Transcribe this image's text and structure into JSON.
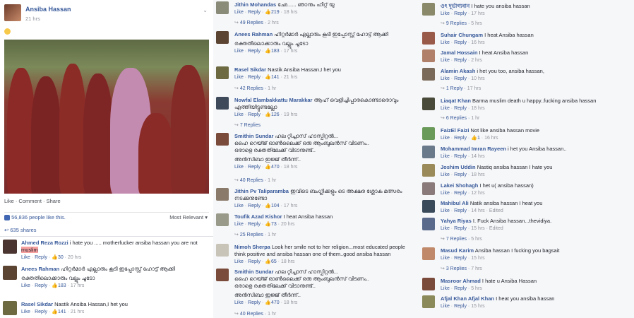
{
  "post": {
    "author": "Ansiba Hassan",
    "time": "21 hrs",
    "actions": "Like · Comment · Share",
    "likes_count": "56,836 people like this.",
    "most_relevant": "Most Relevant ▾",
    "shares": "635 shares"
  },
  "col1_comments": [
    {
      "name": "Ahmed Reza Rozzi",
      "text_pre": "i hate you ..... motherfucker ansiba hassan you are not",
      "highlight": "muslim",
      "text_post": "",
      "likes": "30",
      "time": "20 hrs"
    },
    {
      "name": "Anees Rahman",
      "text_pre": "ഹിറ്റർമാർ എല്ലാരും കൂടി ഇപ്പോസ്റ്റ് ഹോട്ട് ആക്കി",
      "text2": "രക്തതിലൊക്കാരും വല്ലും ചൂടോ",
      "likes": "183",
      "time": "17 hrs"
    },
    {
      "name": "Rasel Sikdar",
      "text_pre": "Nastik Ansiba Hassan,I het you",
      "likes": "141",
      "time": "21 hrs"
    }
  ],
  "col2_comments": [
    {
      "name": "Jithin Mohandas",
      "text": "ഛേ...... ഞാനും ഹിറ്റ് യു",
      "likes": "219",
      "time": "18 hrs",
      "replies": "49 Replies",
      "replies_time": "2 hrs"
    },
    {
      "name": "Anees Rahman",
      "text": "ഹിറ്റർമാർ എല്ലാരും കൂടി ഇപ്പോസ്റ്റ് ഹോട്ട് ആക്കി",
      "text2": "രക്തതിലൊക്കാരും വല്ലും ചൂടോ",
      "likes": "183",
      "time": "17 hrs"
    },
    {
      "name": "Rasel Sikdar",
      "text": "Nastik Ansiba Hassan,I het you",
      "likes": "141",
      "time": "21 hrs",
      "replies": "42 Replies",
      "replies_time": "1 hr"
    },
    {
      "name": "Nowfal Elambakkattu Marakkar",
      "text": "ആഹ് വെളിച്ചിപ്പാരകൊണ്ടാരൊവും എത്തിയിട്ടുണ്ടല്ലോ",
      "likes": "126",
      "time": "19 hrs",
      "replies": "7 Replies"
    },
    {
      "name": "Smithin Sundar",
      "text": "ഹല റ്റിച്ചാസ് ഹാസ്പിറ്റൽ...",
      "text2": "ഹൈ റെയ്ജ് ഓൺലൈക്ക് ഒരു ആംബുലൻസ് വിടണം..",
      "text3": "ഒരാളെ രക്തതിലേക്ക് വിടാനുണ്ട്..",
      "text4": "അൻസിബാ ഇജ്ജ് തീർന്ന്..",
      "likes": "470",
      "time": "18 hrs",
      "replies": "40 Replies",
      "replies_time": "1 hr"
    },
    {
      "name": "Jithin Pv Taliparamba",
      "text": "ഇവിടെ ബംഗ്ലിക്കളും ടെ അക്ഷര ശ്ലോക മത്സരം നടക്കുനുണ്ടോ",
      "likes": "104",
      "time": "17 hrs"
    },
    {
      "name": "Toufik Azad Kishor",
      "text": "I heat Ansiba hassan",
      "likes": "73",
      "time": "20 hrs",
      "replies": "25 Replies",
      "replies_time": "1 hr"
    },
    {
      "name": "Nimoh Sherpa",
      "text": "Look her smile not to her religion...most educated people think positive and ansiba hassan one of them..good ansiba hassan",
      "likes": "65",
      "time": "18 hrs"
    },
    {
      "name": "Smithin Sundar",
      "text": "ഹല റ്റിച്ചാസ് ഹാസ്പിറ്റൽ...",
      "text2": "ഹൈ റെയ്ജ് ഓൺലൈക്ക് ഒരു ആംബുലൻസ് വിടണം..",
      "text3": "ഒരാളെ രക്തതിലേക്ക് വിടാനുണ്ട്..",
      "text4": "അൻസിബാ ഇജ്ജ് തീർന്ന്..",
      "likes": "470",
      "time": "18 hrs",
      "replies": "40 Replies",
      "replies_time": "1 hr"
    }
  ],
  "col3_comments": [
    {
      "name": "ওৎ দূর্ভাগ্যবান",
      "text": "I hate you ansiba hassan",
      "time": "17 hrs",
      "replies": "9 Replies",
      "replies_time": "5 hrs"
    },
    {
      "name": "Suhair Chungam",
      "text": "I heat Ansiba hassan",
      "time": "16 hrs"
    },
    {
      "name": "Jamal Hossain",
      "text": "I heat Ansiba hassan",
      "time": "2 hrs"
    },
    {
      "name": "Alamin Akash",
      "text": "i het you too, ansiba hassan,",
      "time": "10 hrs",
      "replies": "1 Reply",
      "replies_time": "17 hrs"
    },
    {
      "name": "Liaqat Khan",
      "text": "Barma muslim death u happy..fucking ansiba hassan",
      "time": "18 hrs",
      "replies": "6 Replies",
      "replies_time": "1 hr"
    },
    {
      "name": "FaizEl Faizi",
      "text": "Not like ansiba hassan movie",
      "likes": "1",
      "time": "16 hrs"
    },
    {
      "name": "Mohammad Imran Rayeen",
      "text": "i het you Ansiba hassan..",
      "time": "14 hrs"
    },
    {
      "name": "Joshim Uddin",
      "text": "Nastiq ansiba hassan I hate you",
      "time": "18 hrs"
    },
    {
      "name": "Lakei Shohagh",
      "text": "I het u( ansiba hassan)",
      "time": "12 hrs"
    },
    {
      "name": "Mahibul Ali",
      "text": "Natik ansiba hassan I heat you",
      "time": "14 hrs",
      "edited": "Edited"
    },
    {
      "name": "Yahya Riyas",
      "text": "I. Fuck Ansiba hassan...thevidiya.",
      "time": "15 hrs",
      "edited": "Edited",
      "replies": "7 Replies",
      "replies_time": "5 hrs"
    },
    {
      "name": "Masud Karim",
      "text": "Ansiba hassan I fucking you bagsait",
      "time": "15 hrs",
      "replies": "3 Replies",
      "replies_time": "7 hrs"
    },
    {
      "name": "Masroor Ahmad",
      "text": "I hate u Ansiba Hassan",
      "time": "5 hrs"
    },
    {
      "name": "Afjal Khan Afjal Khan",
      "text": "I heat you ansiba hassan",
      "time": "15 hrs"
    }
  ],
  "labels": {
    "like": "Like",
    "reply": "Reply",
    "sep": " · "
  },
  "colors": {
    "link": "#365899",
    "meta": "#90949c",
    "highlight": "#f7a0a0"
  }
}
